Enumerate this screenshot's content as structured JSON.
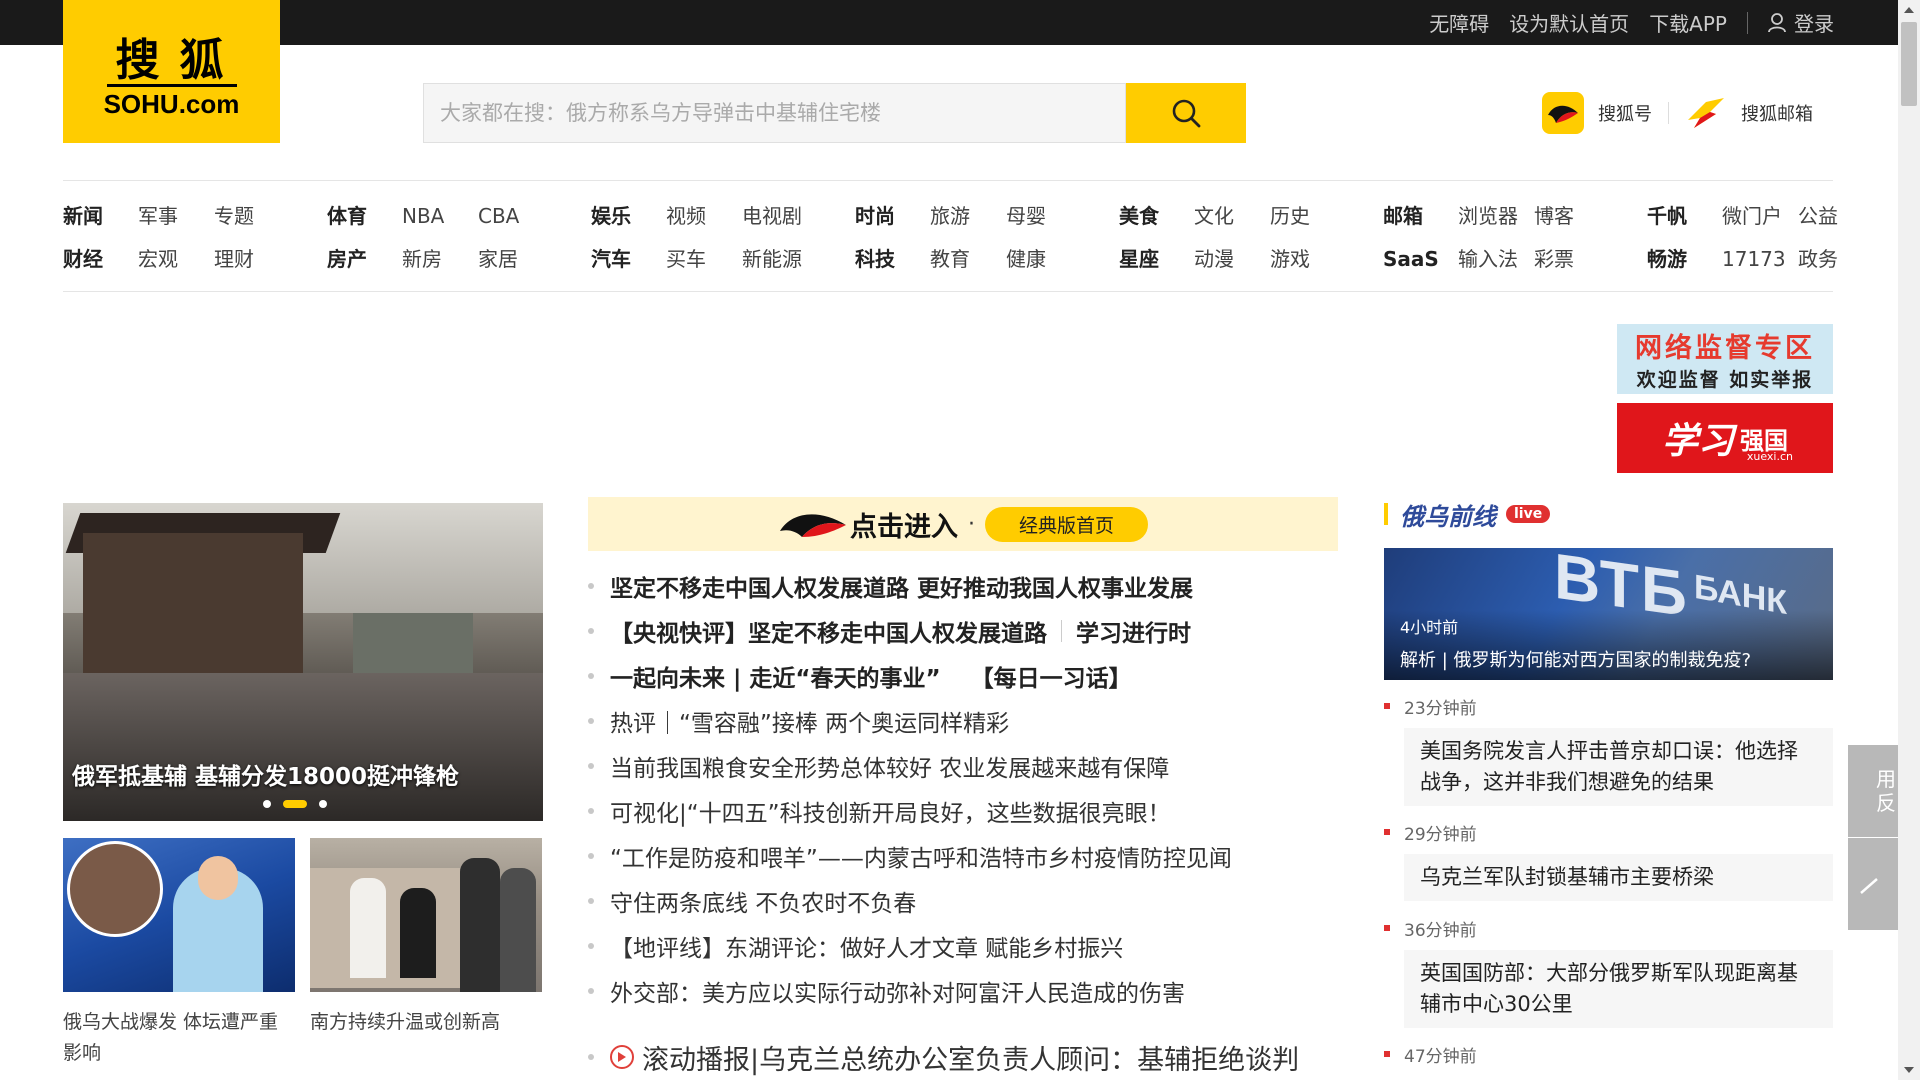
{
  "colors": {
    "brand": "#ffcc00",
    "topbar": "#1a1a1a",
    "accent_red": "#e03030",
    "side_title": "#2e4a9a"
  },
  "topbar": {
    "accessibility": "无障碍",
    "set_home": "设为默认首页",
    "download_app": "下载APP",
    "login": "登录",
    "login_icon": "user-icon"
  },
  "logo": {
    "cn": "搜狐",
    "en": "SOHU.com"
  },
  "search": {
    "placeholder": "大家都在搜：俄方称系乌方导弹击中基辅住宅楼",
    "button_icon": "search-icon"
  },
  "right_links": [
    {
      "label": "搜狐号",
      "icon": "sohu-hao-icon"
    },
    {
      "label": "搜狐邮箱",
      "icon": "sohu-mail-icon"
    }
  ],
  "nav": [
    [
      "新闻",
      "军事",
      "专题",
      "财经",
      "宏观",
      "理财"
    ],
    [
      "体育",
      "NBA",
      "CBA",
      "房产",
      "新房",
      "家居"
    ],
    [
      "娱乐",
      "视频",
      "电视剧",
      "汽车",
      "买车",
      "新能源"
    ],
    [
      "时尚",
      "旅游",
      "母婴",
      "科技",
      "教育",
      "健康"
    ],
    [
      "美食",
      "文化",
      "历史",
      "星座",
      "动漫",
      "游戏"
    ],
    [
      "邮箱",
      "浏览器",
      "博客",
      "SaaS",
      "输入法",
      "彩票"
    ],
    [
      "千帆",
      "微门户",
      "公益",
      "畅游",
      "17173",
      "政务"
    ]
  ],
  "ads": {
    "net_supervision_title": "网络监督专区",
    "net_supervision_sub": "欢迎监督 如实举报",
    "xuexi_title": "学习",
    "xuexi_sub": "强国",
    "xuexi_url": "xuexi.cn"
  },
  "hero": {
    "caption": "俄军抵基辅 基辅分发18000挺冲锋枪",
    "slide_count": 3,
    "active_slide": 2
  },
  "thumbs": [
    {
      "caption": "俄乌大战爆发 体坛遭严重影响"
    },
    {
      "caption": "南方持续升温或创新高"
    }
  ],
  "banner": {
    "title": "点击进入",
    "dot": "·",
    "pill": "经典版首页"
  },
  "news": [
    {
      "bold": true,
      "parts": [
        "坚定不移走中国人权发展道路 更好推动我国人权事业发展"
      ]
    },
    {
      "bold": true,
      "parts": [
        "【央视快评】坚定不移走中国人权发展道路",
        "学习进行时"
      ]
    },
    {
      "bold": true,
      "parts": [
        "一起向未来 | 走近“春天的事业”",
        "【每日一习话】"
      ]
    },
    {
      "bold": false,
      "parts": [
        "热评｜“雪容融”接棒 两个奥运同样精彩"
      ]
    },
    {
      "bold": false,
      "parts": [
        "当前我国粮食安全形势总体较好 农业发展越来越有保障"
      ]
    },
    {
      "bold": false,
      "parts": [
        "可视化|“十四五”科技创新开局良好，这些数据很亮眼！"
      ]
    },
    {
      "bold": false,
      "parts": [
        "“工作是防疫和喂羊”——内蒙古呼和浩特市乡村疫情防控见闻"
      ]
    },
    {
      "bold": false,
      "parts": [
        "守住两条底线 不负农时不负春"
      ]
    },
    {
      "bold": false,
      "parts": [
        "【地评线】东湖评论：做好人才文章 赋能乡村振兴"
      ]
    },
    {
      "bold": false,
      "parts": [
        "外交部：美方应以实际行动弥补对阿富汗人民造成的伤害"
      ]
    }
  ],
  "roll": {
    "text": "滚动播报|乌克兰总统办公室负责人顾问：基辅拒绝谈判"
  },
  "side": {
    "title": "俄乌前线",
    "live": "live",
    "hero_sign_1": "ВТБ",
    "hero_sign_2": "БАНК",
    "hero_time": "4小时前",
    "hero_caption": "解析 | 俄罗斯为何能对西方国家的制裁免疫?",
    "timeline": [
      {
        "time": "23分钟前",
        "text": "美国务院发言人抨击普京却口误：他选择战争，这并非我们想避免的结果"
      },
      {
        "time": "29分钟前",
        "text": "乌克兰军队封锁基辅市主要桥梁"
      },
      {
        "time": "36分钟前",
        "text": "英国国防部：大部分俄罗斯军队现距离基辅市中心30公里"
      },
      {
        "time": "47分钟前",
        "text": ""
      }
    ]
  },
  "float": {
    "feedback": "用反",
    "top_icon": "back-to-top-icon"
  }
}
